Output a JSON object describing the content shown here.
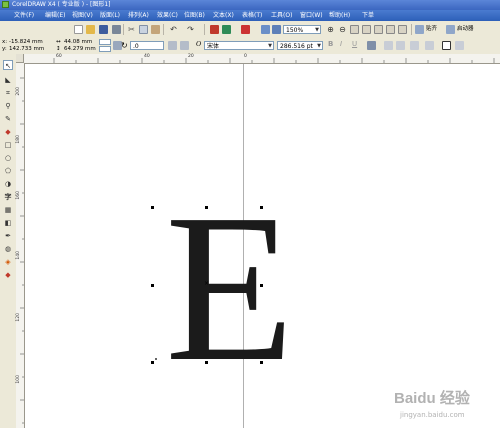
{
  "window": {
    "title": "CorelDRAW X4 ( 专业版 ) - [图形1]"
  },
  "menu": [
    "文件(F)",
    "编辑(E)",
    "视图(V)",
    "版面(L)",
    "排列(A)",
    "效果(C)",
    "位图(B)",
    "文本(X)",
    "表格(T)",
    "工具(O)",
    "窗口(W)",
    "帮助(H)",
    "下单"
  ],
  "toolbar": {
    "zoom_value": "150%",
    "snap_label": "贴齐",
    "launcher_label": "启动器"
  },
  "property_bar": {
    "x_label": "x:",
    "x_value": "-15.824 mm",
    "y_label": "y:",
    "y_value": "142.733 mm",
    "width_value": "44.08 mm",
    "height_value": "64.279 mm",
    "angle_value": ".0",
    "font_name": "宋体",
    "font_size": "286.516 pt"
  },
  "ruler": {
    "top_labels": [
      "60",
      "40",
      "20",
      "0"
    ],
    "left_labels": [
      "200",
      "180",
      "160",
      "140",
      "120",
      "100"
    ]
  },
  "canvas": {
    "letter": "E"
  },
  "watermark": {
    "brand": "Baidu 经验",
    "url": "jingyan.baidu.com"
  }
}
